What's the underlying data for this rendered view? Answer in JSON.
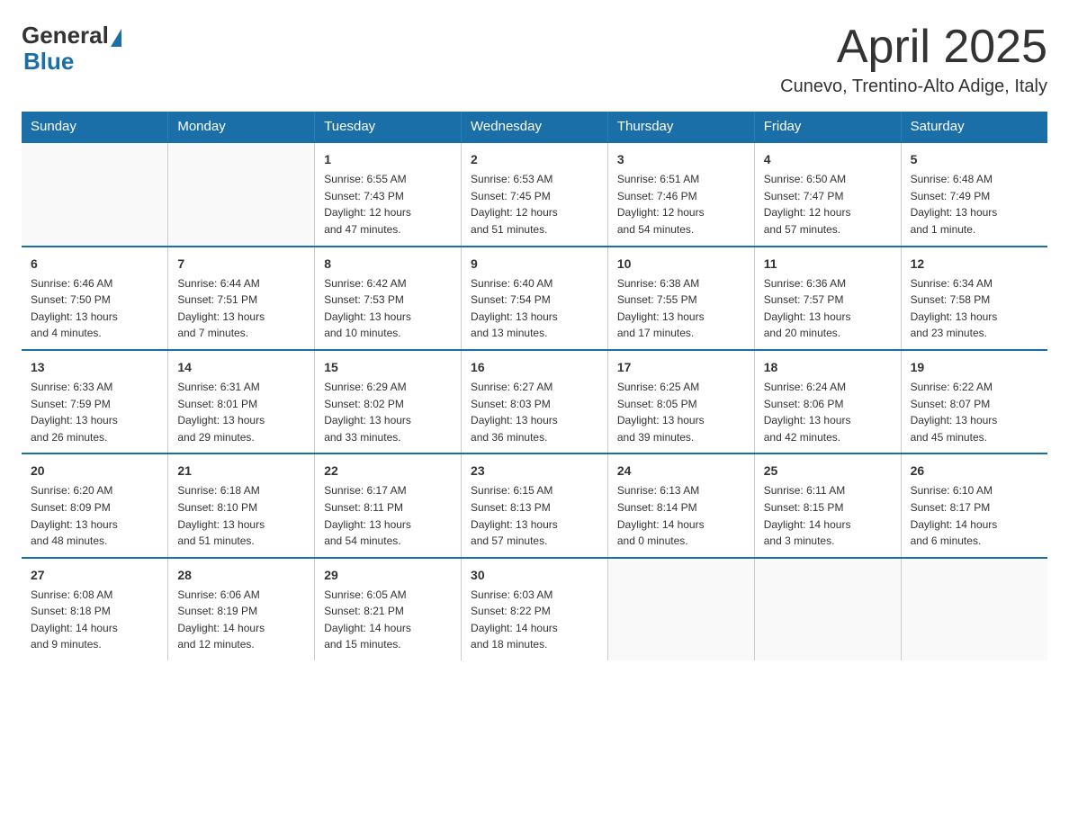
{
  "logo": {
    "general": "General",
    "blue": "Blue"
  },
  "title": "April 2025",
  "subtitle": "Cunevo, Trentino-Alto Adige, Italy",
  "days_of_week": [
    "Sunday",
    "Monday",
    "Tuesday",
    "Wednesday",
    "Thursday",
    "Friday",
    "Saturday"
  ],
  "weeks": [
    [
      {
        "day": "",
        "info": ""
      },
      {
        "day": "",
        "info": ""
      },
      {
        "day": "1",
        "info": "Sunrise: 6:55 AM\nSunset: 7:43 PM\nDaylight: 12 hours\nand 47 minutes."
      },
      {
        "day": "2",
        "info": "Sunrise: 6:53 AM\nSunset: 7:45 PM\nDaylight: 12 hours\nand 51 minutes."
      },
      {
        "day": "3",
        "info": "Sunrise: 6:51 AM\nSunset: 7:46 PM\nDaylight: 12 hours\nand 54 minutes."
      },
      {
        "day": "4",
        "info": "Sunrise: 6:50 AM\nSunset: 7:47 PM\nDaylight: 12 hours\nand 57 minutes."
      },
      {
        "day": "5",
        "info": "Sunrise: 6:48 AM\nSunset: 7:49 PM\nDaylight: 13 hours\nand 1 minute."
      }
    ],
    [
      {
        "day": "6",
        "info": "Sunrise: 6:46 AM\nSunset: 7:50 PM\nDaylight: 13 hours\nand 4 minutes."
      },
      {
        "day": "7",
        "info": "Sunrise: 6:44 AM\nSunset: 7:51 PM\nDaylight: 13 hours\nand 7 minutes."
      },
      {
        "day": "8",
        "info": "Sunrise: 6:42 AM\nSunset: 7:53 PM\nDaylight: 13 hours\nand 10 minutes."
      },
      {
        "day": "9",
        "info": "Sunrise: 6:40 AM\nSunset: 7:54 PM\nDaylight: 13 hours\nand 13 minutes."
      },
      {
        "day": "10",
        "info": "Sunrise: 6:38 AM\nSunset: 7:55 PM\nDaylight: 13 hours\nand 17 minutes."
      },
      {
        "day": "11",
        "info": "Sunrise: 6:36 AM\nSunset: 7:57 PM\nDaylight: 13 hours\nand 20 minutes."
      },
      {
        "day": "12",
        "info": "Sunrise: 6:34 AM\nSunset: 7:58 PM\nDaylight: 13 hours\nand 23 minutes."
      }
    ],
    [
      {
        "day": "13",
        "info": "Sunrise: 6:33 AM\nSunset: 7:59 PM\nDaylight: 13 hours\nand 26 minutes."
      },
      {
        "day": "14",
        "info": "Sunrise: 6:31 AM\nSunset: 8:01 PM\nDaylight: 13 hours\nand 29 minutes."
      },
      {
        "day": "15",
        "info": "Sunrise: 6:29 AM\nSunset: 8:02 PM\nDaylight: 13 hours\nand 33 minutes."
      },
      {
        "day": "16",
        "info": "Sunrise: 6:27 AM\nSunset: 8:03 PM\nDaylight: 13 hours\nand 36 minutes."
      },
      {
        "day": "17",
        "info": "Sunrise: 6:25 AM\nSunset: 8:05 PM\nDaylight: 13 hours\nand 39 minutes."
      },
      {
        "day": "18",
        "info": "Sunrise: 6:24 AM\nSunset: 8:06 PM\nDaylight: 13 hours\nand 42 minutes."
      },
      {
        "day": "19",
        "info": "Sunrise: 6:22 AM\nSunset: 8:07 PM\nDaylight: 13 hours\nand 45 minutes."
      }
    ],
    [
      {
        "day": "20",
        "info": "Sunrise: 6:20 AM\nSunset: 8:09 PM\nDaylight: 13 hours\nand 48 minutes."
      },
      {
        "day": "21",
        "info": "Sunrise: 6:18 AM\nSunset: 8:10 PM\nDaylight: 13 hours\nand 51 minutes."
      },
      {
        "day": "22",
        "info": "Sunrise: 6:17 AM\nSunset: 8:11 PM\nDaylight: 13 hours\nand 54 minutes."
      },
      {
        "day": "23",
        "info": "Sunrise: 6:15 AM\nSunset: 8:13 PM\nDaylight: 13 hours\nand 57 minutes."
      },
      {
        "day": "24",
        "info": "Sunrise: 6:13 AM\nSunset: 8:14 PM\nDaylight: 14 hours\nand 0 minutes."
      },
      {
        "day": "25",
        "info": "Sunrise: 6:11 AM\nSunset: 8:15 PM\nDaylight: 14 hours\nand 3 minutes."
      },
      {
        "day": "26",
        "info": "Sunrise: 6:10 AM\nSunset: 8:17 PM\nDaylight: 14 hours\nand 6 minutes."
      }
    ],
    [
      {
        "day": "27",
        "info": "Sunrise: 6:08 AM\nSunset: 8:18 PM\nDaylight: 14 hours\nand 9 minutes."
      },
      {
        "day": "28",
        "info": "Sunrise: 6:06 AM\nSunset: 8:19 PM\nDaylight: 14 hours\nand 12 minutes."
      },
      {
        "day": "29",
        "info": "Sunrise: 6:05 AM\nSunset: 8:21 PM\nDaylight: 14 hours\nand 15 minutes."
      },
      {
        "day": "30",
        "info": "Sunrise: 6:03 AM\nSunset: 8:22 PM\nDaylight: 14 hours\nand 18 minutes."
      },
      {
        "day": "",
        "info": ""
      },
      {
        "day": "",
        "info": ""
      },
      {
        "day": "",
        "info": ""
      }
    ]
  ]
}
